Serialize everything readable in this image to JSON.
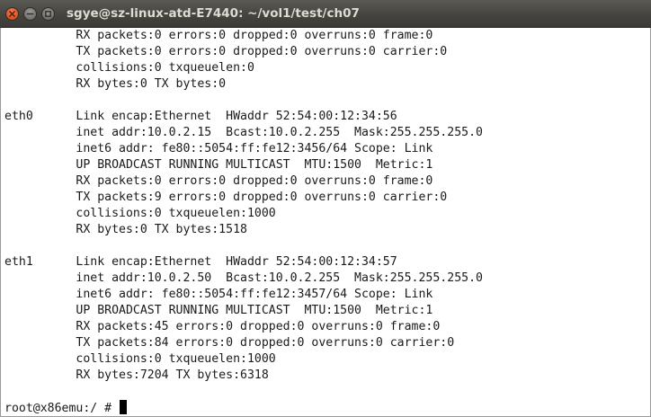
{
  "window": {
    "title": "sgye@sz-linux-atd-E7440: ~/vol1/test/ch07",
    "close_icon": "close-icon",
    "minimize_icon": "minimize-icon",
    "maximize_icon": "maximize-icon"
  },
  "terminal": {
    "lines": [
      "          RX packets:0 errors:0 dropped:0 overruns:0 frame:0",
      "          TX packets:0 errors:0 dropped:0 overruns:0 carrier:0",
      "          collisions:0 txqueuelen:0",
      "          RX bytes:0 TX bytes:0",
      "",
      "eth0      Link encap:Ethernet  HWaddr 52:54:00:12:34:56",
      "          inet addr:10.0.2.15  Bcast:10.0.2.255  Mask:255.255.255.0",
      "          inet6 addr: fe80::5054:ff:fe12:3456/64 Scope: Link",
      "          UP BROADCAST RUNNING MULTICAST  MTU:1500  Metric:1",
      "          RX packets:0 errors:0 dropped:0 overruns:0 frame:0",
      "          TX packets:9 errors:0 dropped:0 overruns:0 carrier:0",
      "          collisions:0 txqueuelen:1000",
      "          RX bytes:0 TX bytes:1518",
      "",
      "eth1      Link encap:Ethernet  HWaddr 52:54:00:12:34:57",
      "          inet addr:10.0.2.50  Bcast:10.0.2.255  Mask:255.255.255.0",
      "          inet6 addr: fe80::5054:ff:fe12:3457/64 Scope: Link",
      "          UP BROADCAST RUNNING MULTICAST  MTU:1500  Metric:1",
      "          RX packets:45 errors:0 dropped:0 overruns:0 frame:0",
      "          TX packets:84 errors:0 dropped:0 overruns:0 carrier:0",
      "          collisions:0 txqueuelen:1000",
      "          RX bytes:7204 TX bytes:6318",
      ""
    ],
    "prompt": "root@x86emu:/ # "
  },
  "colors": {
    "titlebar": "#45443f",
    "title_text": "#dfdbd2",
    "close_button": "#e25a2a",
    "terminal_bg": "#ffffff",
    "terminal_text": "#1a1a1a",
    "cursor": "#000000"
  }
}
